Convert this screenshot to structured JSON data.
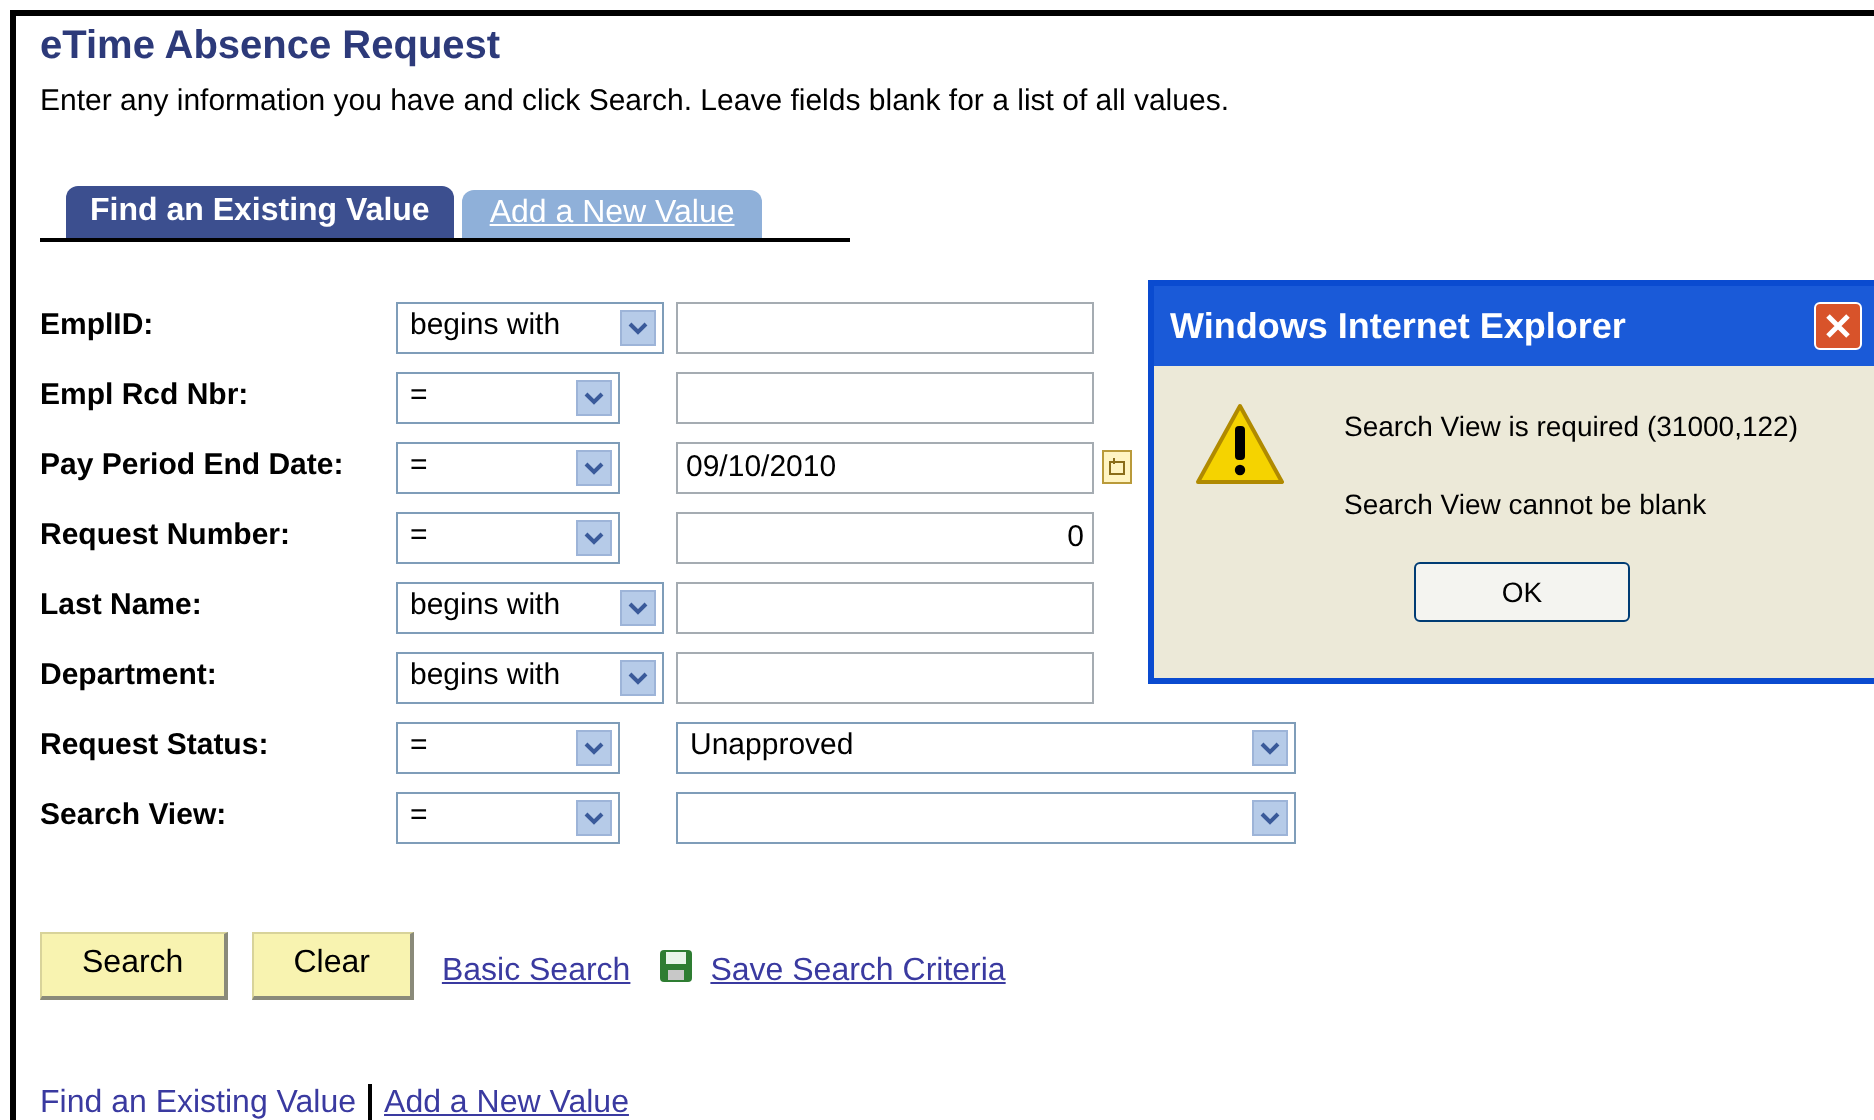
{
  "page": {
    "title": "eTime Absence Request",
    "instructions": "Enter any information you have and click Search. Leave fields blank for a list of all values."
  },
  "tabs": [
    {
      "label": "Find an Existing Value",
      "selected": true
    },
    {
      "label": "Add a New Value",
      "selected": false
    }
  ],
  "fields": [
    {
      "label": "EmplID:",
      "operator": "begins with",
      "kind": "text"
    },
    {
      "label": "Empl Rcd Nbr:",
      "operator": "=",
      "kind": "text"
    },
    {
      "label": "Pay Period End Date:",
      "operator": "=",
      "kind": "date",
      "value": "09/10/2010"
    },
    {
      "label": "Request Number:",
      "operator": "=",
      "kind": "number",
      "value": "0"
    },
    {
      "label": "Last Name:",
      "operator": "begins with",
      "kind": "text"
    },
    {
      "label": "Department:",
      "operator": "begins with",
      "kind": "text"
    },
    {
      "label": "Request Status:",
      "operator": "=",
      "kind": "select",
      "value": "Unapproved"
    },
    {
      "label": "Search View:",
      "operator": "=",
      "kind": "select"
    }
  ],
  "buttons": [
    "Search",
    "Clear"
  ],
  "links": [
    {
      "label": "Basic Search",
      "kind": "plain"
    },
    {
      "label": "Save Search Criteria",
      "kind": "save"
    }
  ],
  "footer_links": [
    {
      "label": "Find an Existing Value",
      "selected": true
    },
    {
      "label": "Add a New Value",
      "selected": false
    }
  ],
  "dialog": {
    "title": "Windows Internet Explorer",
    "messages": [
      "Search View is required (31000,122)",
      "Search View cannot be blank"
    ],
    "button": "OK"
  }
}
